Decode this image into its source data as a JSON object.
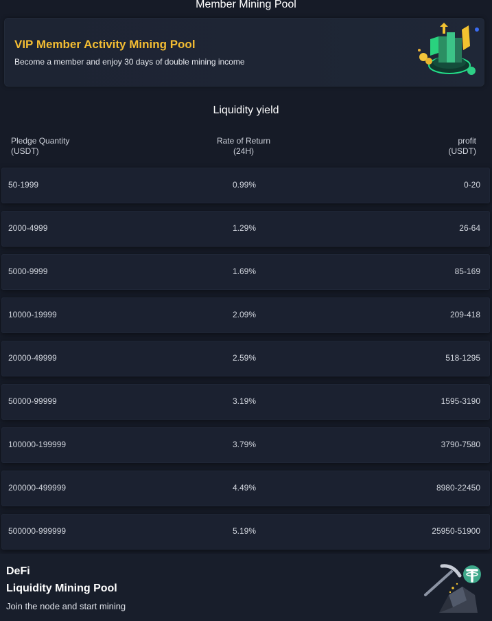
{
  "header": {
    "title": "Member Mining Pool"
  },
  "vip": {
    "title": "VIP Member Activity Mining Pool",
    "subtitle": "Become a member and enjoy 30 days of double mining income",
    "accent": "#f4bd33"
  },
  "liquidity": {
    "title": "Liquidity yield",
    "columns": [
      {
        "line1": "Pledge Quantity",
        "line2": "(USDT)"
      },
      {
        "line1": "Rate of Return",
        "line2": "(24H)"
      },
      {
        "line1": "profit",
        "line2": "(USDT)"
      }
    ],
    "rows": [
      {
        "quantity": "50-1999",
        "rate": "0.99%",
        "profit": "0-20"
      },
      {
        "quantity": "2000-4999",
        "rate": "1.29%",
        "profit": "26-64"
      },
      {
        "quantity": "5000-9999",
        "rate": "1.69%",
        "profit": "85-169"
      },
      {
        "quantity": "10000-19999",
        "rate": "2.09%",
        "profit": "209-418"
      },
      {
        "quantity": "20000-49999",
        "rate": "2.59%",
        "profit": "518-1295"
      },
      {
        "quantity": "50000-99999",
        "rate": "3.19%",
        "profit": "1595-3190"
      },
      {
        "quantity": "100000-199999",
        "rate": "3.79%",
        "profit": "3790-7580"
      },
      {
        "quantity": "200000-499999",
        "rate": "4.49%",
        "profit": "8980-22450"
      },
      {
        "quantity": "500000-999999",
        "rate": "5.19%",
        "profit": "25950-51900"
      }
    ]
  },
  "defi": {
    "line1": "DeFi",
    "line2": "Liquidity Mining Pool",
    "subtitle": "Join the node and start mining",
    "icons": [
      "mining-pickaxe-icon",
      "tether-coin-icon"
    ]
  }
}
